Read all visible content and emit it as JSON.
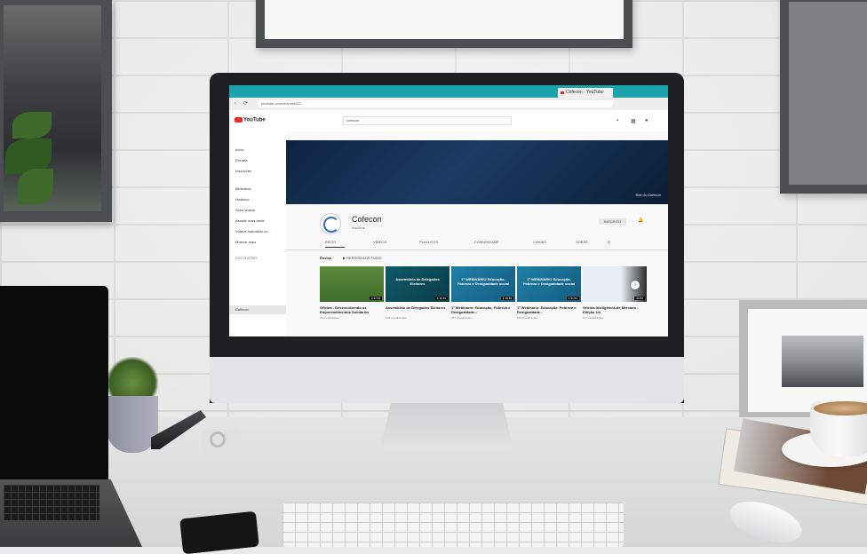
{
  "browser": {
    "tab_title": "Cofecon - YouTube",
    "url": "youtube.com/channel/UC...",
    "nav_back": "‹",
    "nav_reload": "⟳"
  },
  "youtube": {
    "logo_text": "YouTube",
    "search_value": "cofecon",
    "header_icons": [
      "video-camera-icon",
      "apps-grid-icon",
      "bell-icon"
    ],
    "sidebar": [
      "Início",
      "Em alta",
      "Inscrições",
      "Biblioteca",
      "Histórico",
      "Seus vídeos",
      "Assistir mais tarde",
      "Vídeos marcados co...",
      "Mostrar mais",
      "INSCRIÇÕES",
      "Cofecon"
    ],
    "banner_links": "Site do Cofecon",
    "channel": {
      "name": "Cofecon",
      "subscribers": "inscritos",
      "subscribe_button": "INSCRITO",
      "tabs": [
        "INÍCIO",
        "VÍDEOS",
        "PLAYLISTS",
        "COMUNIDADE",
        "CANAIS",
        "SOBRE"
      ],
      "shelf_title": "Envios",
      "play_all": "▶ REPRODUZIR TUDO"
    },
    "videos": [
      {
        "thumb_text": "",
        "duration": "2:17:06",
        "title": "Oficina - Desenvolvendo os Empreendimentos Solidários",
        "meta": "47 visualizações"
      },
      {
        "thumb_text": "Assembleia de Delegados Eleitores",
        "duration": "1:16:15",
        "title": "Assembleia de Delegados Eleitores",
        "meta": "129 visualizações"
      },
      {
        "thumb_text": "1ª WEBINÁRIO Educação, Pobreza e Desigualdade social",
        "duration": "1:38:48",
        "title": "1º Webinário: Educação, Pobreza e Desigualdade...",
        "meta": "227 visualizações"
      },
      {
        "thumb_text": "1ª WEBINÁRIO Educação, Pobreza e Desigualdade social",
        "duration": "1:31:51",
        "title": "1º Webinário: Educação, Pobreza e Desigualdade...",
        "meta": "216 visualizações"
      },
      {
        "thumb_text": "",
        "duration": "20:52",
        "title": "Oficina Inteligência de Mercado - Edição 1/4",
        "meta": "117 visualizações"
      }
    ]
  },
  "colors": {
    "tabbar": "#1aa3ab",
    "banner": "#1b3c63",
    "youtube_red": "#e52d27"
  }
}
